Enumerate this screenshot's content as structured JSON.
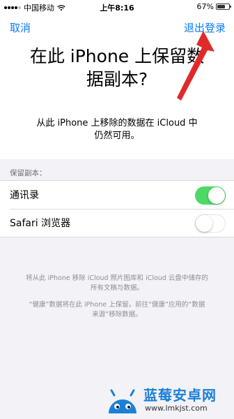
{
  "status_bar": {
    "carrier": "中国移动",
    "time": "上午8:16",
    "battery": "67%",
    "battery_level": 0.67
  },
  "nav": {
    "cancel_label": "取消",
    "sign_out_label": "退出登录"
  },
  "dialog": {
    "title_line1": "在此 iPhone 上保留数",
    "title_line2": "据副本?",
    "desc_line1": "从此 iPhone 上移除的数据在 iCloud 中",
    "desc_line2": "仍然可用。"
  },
  "keep_section": {
    "header": "保留副本：",
    "items": [
      {
        "label": "通讯录",
        "enabled": true
      },
      {
        "label": "Safari 浏览器",
        "enabled": false
      }
    ]
  },
  "footer": {
    "note1_line1": "将从此 iPhone 移除 iCloud 照片图库和 iCloud 云盘中储存的",
    "note1_line2": "所有文稿与数据。",
    "note2_line1": "“健康”数据将在此 iPhone 上保留。前往“健康”应用的“数据",
    "note2_line2": "来源”移除数据。"
  },
  "watermark": {
    "title": "蓝莓安卓网",
    "url": "www.lmkjst.com"
  },
  "colors": {
    "accent": "#0a7aff",
    "toggle_on": "#4cd964",
    "arrow": "#e02a2a"
  }
}
